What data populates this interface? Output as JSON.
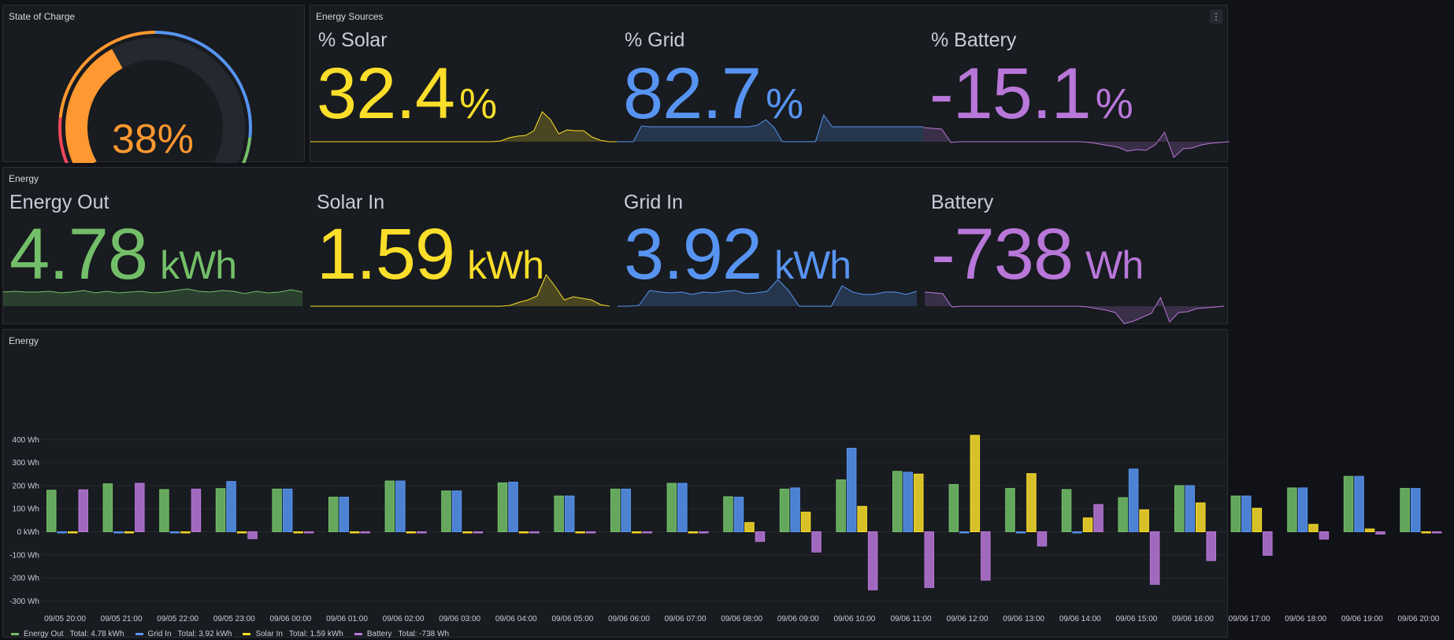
{
  "colors": {
    "green": "#73bf69",
    "blue": "#5794f2",
    "yellow": "#fade2a",
    "purple": "#b877d9",
    "orange": "#ff9830",
    "red": "#f2495c"
  },
  "soc_panel": {
    "title": "State of Charge",
    "value": 38,
    "display": "38%"
  },
  "sources_panel": {
    "title": "Energy Sources",
    "menu_icon": "kebab-menu-icon",
    "stats": [
      {
        "label": "% Solar",
        "value": "32.4",
        "unit": "%",
        "color": "#fade2a",
        "spark": [
          0,
          0,
          0,
          0,
          0,
          0,
          0,
          0,
          0,
          0,
          0,
          0,
          0,
          0,
          0,
          0,
          0,
          0,
          0,
          0,
          0,
          0,
          0,
          1,
          5,
          7,
          8,
          14,
          38,
          28,
          10,
          15,
          14,
          14,
          6,
          2,
          0,
          0
        ]
      },
      {
        "label": "% Grid",
        "value": "82.7",
        "unit": "%",
        "color": "#5794f2",
        "spark": [
          0,
          0,
          0,
          20,
          19,
          19,
          19,
          19,
          19,
          19,
          19,
          19,
          19,
          19,
          19,
          19,
          19,
          21,
          28,
          18,
          0,
          0,
          0,
          0,
          0,
          34,
          19,
          19,
          19,
          19,
          19,
          19,
          19,
          19,
          19,
          19,
          19,
          19
        ]
      },
      {
        "label": "% Battery",
        "value": "-15.1",
        "unit": "%",
        "color": "#b877d9",
        "spark": [
          18,
          17,
          16,
          -1,
          0,
          0,
          0,
          0,
          0,
          0,
          0,
          0,
          0,
          0,
          0,
          0,
          0,
          0,
          -1,
          -3,
          -5,
          -7,
          -12,
          -10,
          -11,
          -4,
          12,
          -20,
          -9,
          -8,
          -4,
          -2,
          -1,
          0
        ]
      }
    ]
  },
  "energy_panel": {
    "title": "Energy",
    "stats": [
      {
        "label": "Energy Out",
        "value": "4.78",
        "unit": "kWh",
        "color": "#73bf69",
        "spark": [
          18,
          19,
          18,
          18,
          19,
          17,
          18,
          20,
          17,
          19,
          17,
          18,
          19,
          17,
          18,
          20,
          22,
          19,
          18,
          20,
          19,
          16,
          19,
          17,
          18,
          21,
          18
        ]
      },
      {
        "label": "Solar In",
        "value": "1.59",
        "unit": "kWh",
        "color": "#fade2a",
        "spark": [
          0,
          0,
          0,
          0,
          0,
          0,
          0,
          0,
          0,
          0,
          0,
          0,
          0,
          0,
          0,
          0,
          0,
          0,
          0,
          0,
          0,
          0,
          1,
          5,
          8,
          13,
          40,
          25,
          8,
          12,
          10,
          8,
          2,
          0
        ]
      },
      {
        "label": "Grid In",
        "value": "3.92",
        "unit": "kWh",
        "color": "#5794f2",
        "spark": [
          0,
          0,
          1,
          20,
          18,
          17,
          18,
          15,
          18,
          17,
          19,
          20,
          16,
          17,
          19,
          34,
          20,
          0,
          0,
          0,
          0,
          26,
          18,
          15,
          15,
          18,
          18,
          15,
          19
        ]
      },
      {
        "label": "Battery",
        "value": "-738",
        "unit": "Wh",
        "color": "#b877d9",
        "spark": [
          18,
          17,
          16,
          -1,
          0,
          0,
          0,
          0,
          0,
          0,
          0,
          0,
          0,
          0,
          0,
          0,
          0,
          0,
          -1,
          -3,
          -5,
          -8,
          -22,
          -19,
          -14,
          -9,
          11,
          -20,
          -8,
          -7,
          -3,
          -2,
          -1,
          0
        ]
      }
    ]
  },
  "chart_panel": {
    "title": "Energy",
    "legend": [
      {
        "name": "Energy Out",
        "color": "#73bf69",
        "summary": "Total: 4.78 kWh"
      },
      {
        "name": "Grid In",
        "color": "#5794f2",
        "summary": "Total: 3.92 kWh"
      },
      {
        "name": "Solar In",
        "color": "#fade2a",
        "summary": "Total: 1.59 kWh"
      },
      {
        "name": "Battery",
        "color": "#b877d9",
        "summary": "Total: -738 Wh"
      }
    ]
  },
  "chart_data": {
    "type": "bar",
    "ylim": [
      -300,
      400
    ],
    "yticks": [
      -300,
      -200,
      -100,
      0,
      100,
      200,
      300,
      400
    ],
    "ytick_labels": [
      "-300 Wh",
      "-200 Wh",
      "-100 Wh",
      "0 kWh",
      "100 Wh",
      "200 Wh",
      "300 Wh",
      "400 Wh"
    ],
    "grid": true,
    "legend_position": "bottom",
    "categories": [
      "09/05 20:00",
      "09/05 21:00",
      "09/05 22:00",
      "09/05 23:00",
      "09/06 00:00",
      "09/06 01:00",
      "09/06 02:00",
      "09/06 03:00",
      "09/06 04:00",
      "09/06 05:00",
      "09/06 06:00",
      "09/06 07:00",
      "09/06 08:00",
      "09/06 09:00",
      "09/06 10:00",
      "09/06 11:00",
      "09/06 12:00",
      "09/06 13:00",
      "09/06 14:00",
      "09/06 15:00",
      "09/06 16:00",
      "09/06 17:00",
      "09/06 18:00",
      "09/06 19:00",
      "09/06 20:00"
    ],
    "series": [
      {
        "name": "Energy Out",
        "color": "#73bf69",
        "values": [
          180,
          208,
          183,
          187,
          185,
          150,
          220,
          177,
          212,
          155,
          185,
          210,
          152,
          185,
          225,
          262,
          205,
          188,
          183,
          148,
          200,
          155,
          190,
          240,
          188
        ]
      },
      {
        "name": "Grid In",
        "color": "#5794f2",
        "values": [
          -3,
          -3,
          -3,
          218,
          185,
          150,
          220,
          177,
          215,
          155,
          185,
          210,
          150,
          190,
          362,
          258,
          -3,
          -3,
          -3,
          272,
          200,
          155,
          190,
          240,
          188
        ]
      },
      {
        "name": "Solar In",
        "color": "#fade2a",
        "values": [
          -3,
          -3,
          -3,
          0,
          -3,
          0,
          -3,
          -3,
          -3,
          -3,
          -3,
          -3,
          40,
          85,
          110,
          250,
          418,
          252,
          60,
          95,
          125,
          102,
          32,
          12,
          -3
        ]
      },
      {
        "name": "Battery",
        "color": "#b877d9",
        "values": [
          182,
          210,
          185,
          -30,
          -3,
          -3,
          -3,
          -3,
          -5,
          -3,
          -3,
          -3,
          -42,
          -88,
          -252,
          -242,
          -210,
          -62,
          118,
          -228,
          -125,
          -102,
          -32,
          -10,
          0
        ]
      }
    ]
  }
}
